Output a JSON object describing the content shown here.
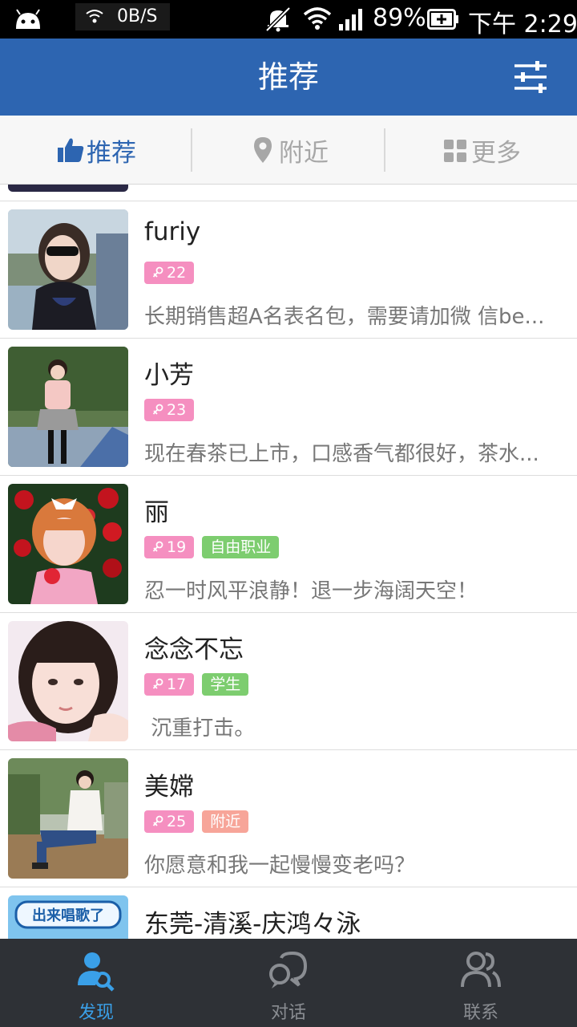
{
  "status_bar": {
    "net_speed": "0B/S",
    "battery_percent": "89%",
    "time": "下午 2:29"
  },
  "header": {
    "title": "推荐",
    "filter_icon": "sliders-icon"
  },
  "tabs": [
    {
      "label": "推荐",
      "icon": "thumbs-up-icon",
      "active": true
    },
    {
      "label": "附近",
      "icon": "location-pin-icon",
      "active": false
    },
    {
      "label": "更多",
      "icon": "grid-icon",
      "active": false
    }
  ],
  "users": [
    {
      "name": "furiy",
      "age": "22",
      "tags": [],
      "desc": "长期销售超A名表名包，需要请加微 信be..."
    },
    {
      "name": "小芳",
      "age": "23",
      "tags": [],
      "desc": "现在春茶已上市，口感香气都很好，茶水..."
    },
    {
      "name": "丽",
      "age": "19",
      "tags": [
        "自由职业"
      ],
      "desc": "忍一时风平浪静！退一步海阔天空！"
    },
    {
      "name": "念念不忘",
      "age": "17",
      "tags": [
        "学生"
      ],
      "desc": " 沉重打击。"
    },
    {
      "name": "美嫦",
      "age": "25",
      "tags": [
        "附近"
      ],
      "desc": "你愿意和我一起慢慢变老吗？"
    },
    {
      "name": "东莞-清溪-庆鸿々泳",
      "age": "",
      "tags": [],
      "desc": ""
    }
  ],
  "thumb_text": "出来唱歌了",
  "bottom_nav": [
    {
      "label": "发现",
      "icon": "discover-person-search-icon",
      "active": true
    },
    {
      "label": "对话",
      "icon": "chat-bubbles-icon",
      "active": false
    },
    {
      "label": "联系",
      "icon": "contacts-icon",
      "active": false
    }
  ],
  "colors": {
    "header_blue": "#2d65b1",
    "active_nav": "#3aa0e8",
    "age_badge": "#f58fc0",
    "job_badge": "#7dcd6f",
    "near_badge": "#f7a599"
  }
}
